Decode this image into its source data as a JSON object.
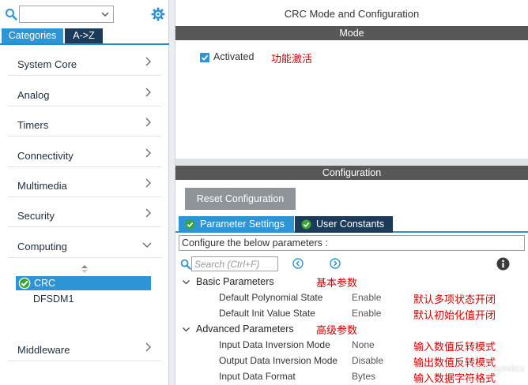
{
  "left": {
    "categories_tab": "Categories",
    "az_tab": "A->Z",
    "categories": [
      "System Core",
      "Analog",
      "Timers",
      "Connectivity",
      "Multimedia",
      "Security",
      "Computing"
    ],
    "computing_items": [
      "CRC",
      "DFSDM1"
    ],
    "middleware": "Middleware"
  },
  "right": {
    "title": "CRC Mode and Configuration",
    "mode_header": "Mode",
    "activated_label": "Activated",
    "activated_checked": true,
    "activated_annotation": "功能激活",
    "config_header": "Configuration",
    "reset_button": "Reset Configuration",
    "tabs": [
      "Parameter Settings",
      "User Constants"
    ],
    "configure_text": "Configure the below parameters :",
    "search_placeholder": "Search (Ctrl+F)",
    "groups": [
      {
        "label": "Basic Parameters",
        "annotation": "基本参数",
        "params": [
          {
            "name": "Default Polynomial State",
            "value": "Enable",
            "annotation": "默认多项状态开闭"
          },
          {
            "name": "Default Init Value State",
            "value": "Enable",
            "annotation": "默认初始化值开闭"
          }
        ]
      },
      {
        "label": "Advanced Parameters",
        "annotation": "高级参数",
        "params": [
          {
            "name": "Input Data Inversion Mode",
            "value": "None",
            "annotation": "输入数值反转模式"
          },
          {
            "name": "Output Data Inversion Mode",
            "value": "Disable",
            "annotation": "输出数值反转模式"
          },
          {
            "name": "Input Data Format",
            "value": "Bytes",
            "annotation": "输入数据字符格式"
          }
        ]
      }
    ]
  },
  "watermark": "CSDN @Grayrelics"
}
